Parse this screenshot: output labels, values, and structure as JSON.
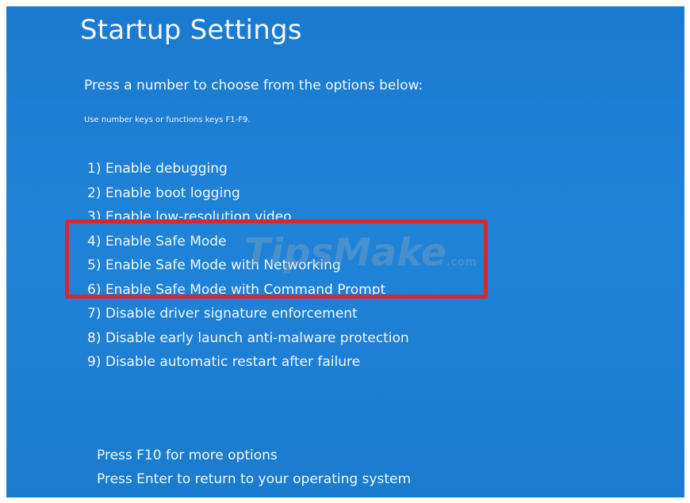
{
  "screen": {
    "title": "Startup Settings",
    "subtitle": "Press a number to choose from the options below:",
    "hint": "Use number keys or functions keys F1-F9.",
    "options": [
      "1) Enable debugging",
      "2) Enable boot logging",
      "3) Enable low-resolution video",
      "4) Enable Safe Mode",
      "5) Enable Safe Mode with Networking",
      "6) Enable Safe Mode with Command Prompt",
      "7) Disable driver signature enforcement",
      "8) Disable early launch anti-malware protection",
      "9) Disable automatic restart after failure"
    ],
    "footer": {
      "more_options": "Press F10 for more options",
      "return": "Press Enter to return to your operating system"
    }
  },
  "watermark": {
    "text": "TipsMake",
    "suffix": ".com"
  },
  "colors": {
    "background": "#1f83d8",
    "text": "#f3f7fb",
    "highlight_border": "#d8272d"
  }
}
